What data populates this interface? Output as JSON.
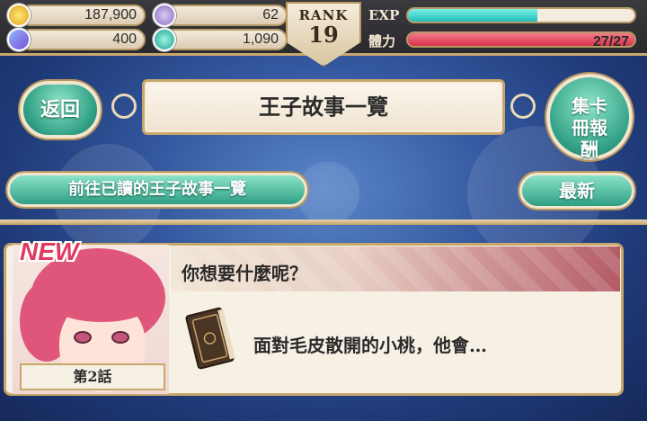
{
  "topbar": {
    "gold": "187,900",
    "tickets": "62",
    "crystals": "400",
    "gems": "1,090",
    "rank_label": "RANK",
    "rank_value": "19",
    "exp_label": "EXP",
    "exp_fraction": 0.57,
    "stamina_label": "體力",
    "stamina_text": "27/27",
    "stamina_fraction": 1.0,
    "icons": [
      "gold-coin-icon",
      "ticket-icon",
      "crystal-icon",
      "gem-icon"
    ]
  },
  "nav": {
    "back_label": "返回",
    "page_title": "王子故事一覽",
    "album_rewards_label": "集卡冊報酬",
    "read_stories_label": "前往已讀的王子故事一覽",
    "latest_label": "最新"
  },
  "story": {
    "new_badge": "NEW",
    "question": "你想要什麼呢？",
    "description": "面對毛皮散開的小桃，他會…",
    "episode": "第2話"
  },
  "colors": {
    "accent_teal": "#2f9f84",
    "exp_bar": "#2cc9c9",
    "stamina_bar": "#e3455c",
    "frame_gold": "#c9a66b",
    "new_badge": "#e23a5d"
  }
}
